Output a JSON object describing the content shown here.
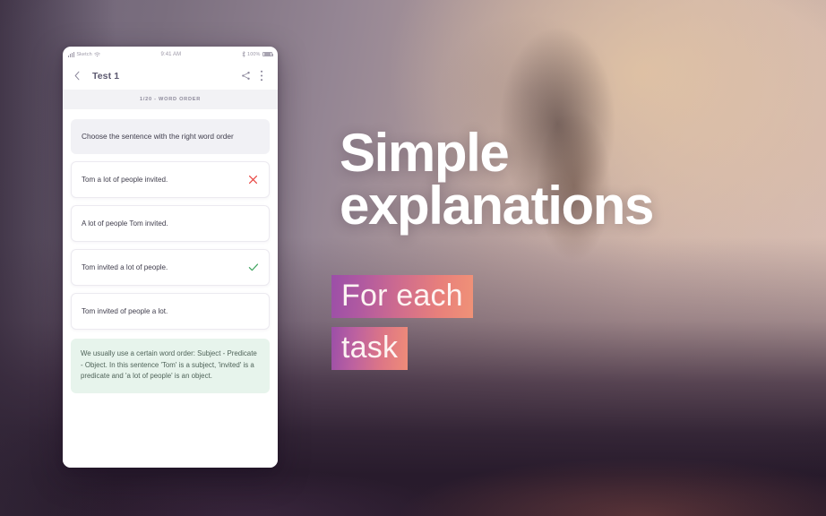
{
  "phone": {
    "status_bar": {
      "carrier": "Sketch",
      "signal_icon": "signal-bars-icon",
      "wifi_icon": "wifi-icon",
      "time": "9:41 AM",
      "bluetooth_icon": "bluetooth-icon",
      "battery_percent": "100%",
      "battery_icon": "battery-full-icon"
    },
    "nav": {
      "back_icon": "chevron-left-icon",
      "title": "Test 1",
      "share_icon": "share-icon",
      "overflow_icon": "more-vertical-icon"
    },
    "progress_label": "1/20 - WORD ORDER",
    "question": "Choose the sentence with the right word order",
    "options": [
      {
        "text": "Tom a lot of people invited.",
        "mark": "incorrect",
        "mark_icon": "close-icon"
      },
      {
        "text": "A lot of people Tom invited.",
        "mark": "none",
        "mark_icon": ""
      },
      {
        "text": "Tom invited a lot of people.",
        "mark": "correct",
        "mark_icon": "check-icon"
      },
      {
        "text": "Tom invited of people a lot.",
        "mark": "none",
        "mark_icon": ""
      }
    ],
    "explanation": "We usually use a certain word order: Subject - Predicate - Object. In this sentence 'Tom' is a subject, 'invited' is a predicate and 'a lot of people' is an object."
  },
  "promo": {
    "headline_line1": "Simple",
    "headline_line2": "explanations",
    "highlight_line1": "For each",
    "highlight_line2": "task"
  },
  "colors": {
    "incorrect_mark": "#e8433f",
    "correct_mark": "#3da35d",
    "explanation_bg": "#e7f4ec",
    "question_bg": "#f1f1f5",
    "gradient_start": "#9b4fa8",
    "gradient_end": "#f09277",
    "headline_text": "#ffffff"
  }
}
